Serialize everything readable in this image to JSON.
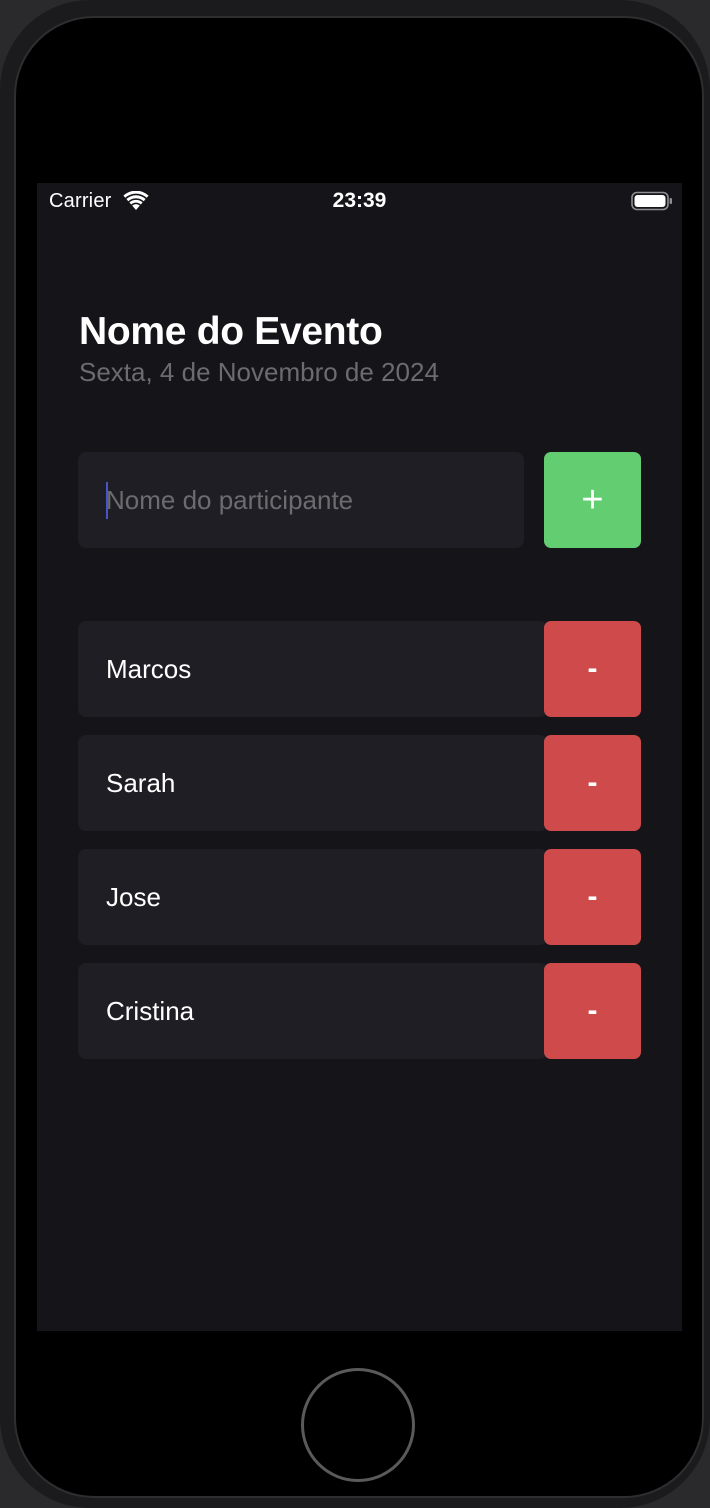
{
  "status_bar": {
    "carrier": "Carrier",
    "time": "23:39"
  },
  "event": {
    "title": "Nome do Evento",
    "date": "Sexta, 4 de Novembro de 2024"
  },
  "participant_input": {
    "placeholder": "Nome do participante",
    "value": ""
  },
  "add_button": {
    "label": "+",
    "color": "#63cd72"
  },
  "participants": [
    {
      "name": "Marcos",
      "remove_label": "-"
    },
    {
      "name": "Sarah",
      "remove_label": "-"
    },
    {
      "name": "Jose",
      "remove_label": "-"
    },
    {
      "name": "Cristina",
      "remove_label": "-"
    }
  ],
  "colors": {
    "background": "#151418",
    "card": "#1f1e24",
    "remove": "#cf4a4a",
    "muted_text": "#6b6b70"
  },
  "icons": {
    "wifi": "wifi-icon",
    "battery": "battery-icon",
    "home": "home-button"
  }
}
